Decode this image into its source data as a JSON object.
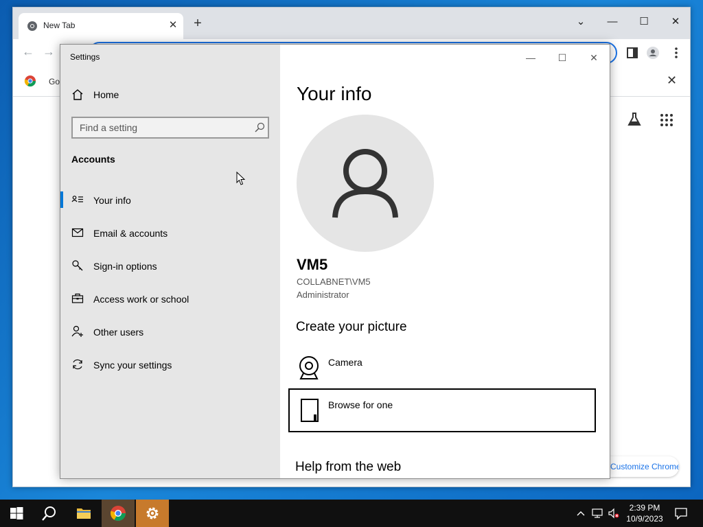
{
  "chrome": {
    "tab_title": "New Tab",
    "tab_close": "✕",
    "new_tab": "+",
    "bookmark_label": "Goo",
    "bookmark_close": "✕",
    "customize_label": "Customize Chrome",
    "win_minimize": "⌄",
    "win_restore": "☐",
    "win_close": "✕"
  },
  "settings": {
    "app_title": "Settings",
    "home_label": "Home",
    "search_placeholder": "Find a setting",
    "section": "Accounts",
    "nav": [
      {
        "label": "Your info",
        "icon": "person-card-icon",
        "active": true
      },
      {
        "label": "Email & accounts",
        "icon": "mail-icon",
        "active": false
      },
      {
        "label": "Sign-in options",
        "icon": "key-icon",
        "active": false
      },
      {
        "label": "Access work or school",
        "icon": "briefcase-icon",
        "active": false
      },
      {
        "label": "Other users",
        "icon": "add-person-icon",
        "active": false
      },
      {
        "label": "Sync your settings",
        "icon": "sync-icon",
        "active": false
      }
    ],
    "win_minimize": "—",
    "win_maximize": "☐",
    "win_close": "✕",
    "content": {
      "title": "Your info",
      "user_name": "VM5",
      "user_domain": "COLLABNET\\VM5",
      "user_role": "Administrator",
      "create_head": "Create your picture",
      "camera_label": "Camera",
      "browse_label": "Browse for one",
      "help_head": "Help from the web"
    }
  },
  "taskbar": {
    "time": "2:39 PM",
    "date": "10/9/2023"
  },
  "colors": {
    "accent": "#0078d7",
    "sidebar_bg": "#e6e6e6",
    "taskbar_bg": "#101010",
    "active_task": "#c77a2c"
  }
}
